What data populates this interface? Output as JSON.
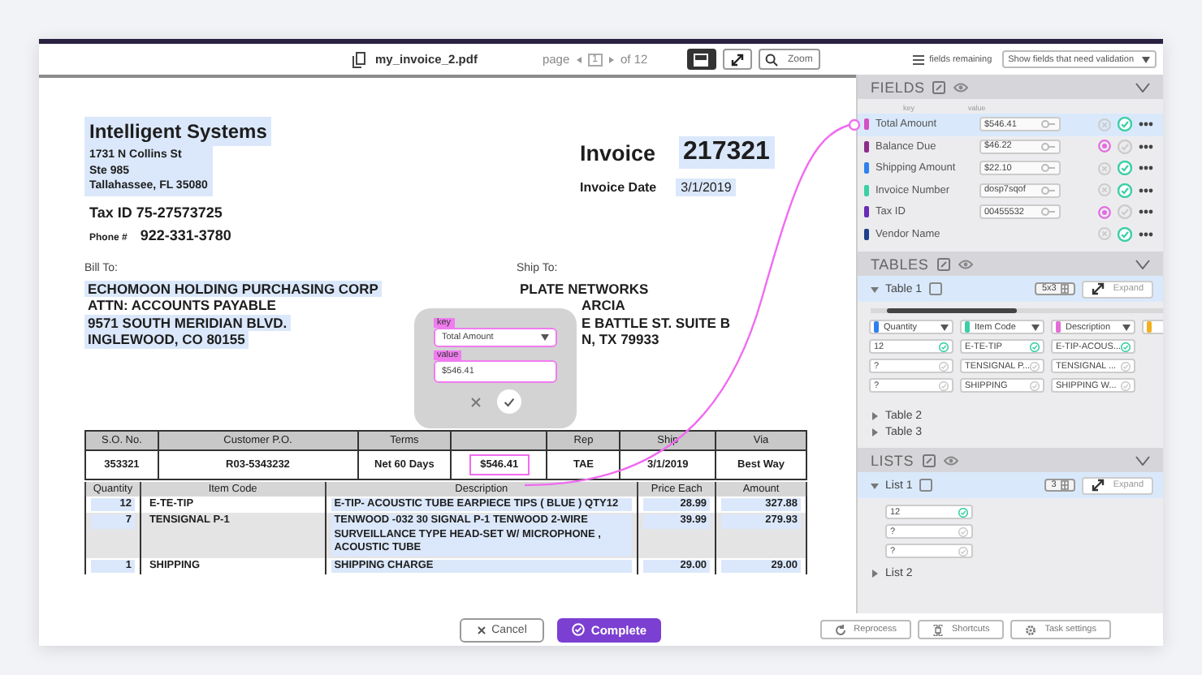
{
  "toolbar": {
    "file_name": "my_invoice_2.pdf",
    "page_label": "page",
    "page_number": "1",
    "page_total": "of 12",
    "zoom_label": "Zoom",
    "fields_remaining": "fields remaining",
    "filter": "Show fields that need validation"
  },
  "document": {
    "company": {
      "name": "Intelligent Systems",
      "address": [
        "1731 N Collins St",
        "Ste 985",
        "Tallahassee, FL 35080"
      ]
    },
    "tax_id": "Tax ID 75-27573725",
    "phone_label": "Phone #",
    "phone": "922-331-3780",
    "invoice_label": "Invoice",
    "invoice_number": "217321",
    "date_label": "Invoice Date",
    "date": "3/1/2019",
    "bill_to": {
      "label": "Bill To:",
      "lines": [
        {
          "text": "ECHOMOON HOLDING PURCHASING CORP",
          "highlighted": true
        },
        {
          "text": "ATTN: ACCOUNTS PAYABLE",
          "highlighted": false
        },
        {
          "text": "9571 SOUTH MERIDIAN BLVD.",
          "highlighted": true
        },
        {
          "text": "INGLEWOOD, CO 80155",
          "highlighted": true
        }
      ]
    },
    "ship_to": {
      "label": "Ship To:",
      "lines": [
        {
          "text": "PLATE NETWORKS",
          "kind": "full"
        },
        {
          "text": "ARCIA",
          "kind": "partial"
        },
        {
          "text": "E BATTLE ST. SUITE B",
          "kind": "partial"
        },
        {
          "text": "N, TX 79933",
          "kind": "partial"
        }
      ]
    },
    "summary": {
      "columns": [
        {
          "kind": "text",
          "label": "S.O. No."
        },
        {
          "kind": "text",
          "label": "Customer P.O."
        },
        {
          "kind": "text",
          "label": "Terms"
        },
        {
          "kind": "covered"
        },
        {
          "kind": "text",
          "label": "Rep"
        },
        {
          "kind": "text",
          "label": "Ship"
        },
        {
          "kind": "text",
          "label": "Via"
        }
      ],
      "row": [
        {
          "text": "353321",
          "selected": false
        },
        {
          "text": "R03-5343232",
          "selected": false
        },
        {
          "text": "Net 60 Days",
          "selected": false
        },
        {
          "text": "$546.41",
          "selected": true
        },
        {
          "text": "TAE",
          "selected": false
        },
        {
          "text": "3/1/2019",
          "selected": false
        },
        {
          "text": "Best Way",
          "selected": false
        }
      ]
    },
    "items": {
      "columns": [
        "Quantity",
        "Item Code",
        "Description",
        "Price Each",
        "Amount"
      ],
      "rows": [
        {
          "selected": false,
          "cells": [
            "12",
            "E-TE-TIP",
            "E-TIP- ACOUSTIC TUBE EARPIECE TIPS ( BLUE ) QTY12",
            "28.99",
            "327.88"
          ]
        },
        {
          "selected": true,
          "cells": [
            "7",
            "TENSIGNAL P-1",
            "TENWOOD -032 30  SIGNAL P-1 TENWOOD 2-WIRE SURVEILLANCE TYPE HEAD-SET W/ MICROPHONE , ACOUSTIC TUBE",
            "39.99",
            "279.93"
          ]
        },
        {
          "selected": false,
          "cells": [
            "1",
            "SHIPPING",
            "SHIPPING CHARGE",
            "29.00",
            "29.00"
          ]
        }
      ]
    }
  },
  "popup": {
    "key_label": "key",
    "key": "Total Amount",
    "value_label": "value",
    "value": "$546.41"
  },
  "actions": [
    {
      "label": "Cancel",
      "kind": "secondary"
    },
    {
      "label": "Complete",
      "kind": "primary"
    }
  ],
  "panel": {
    "fields": {
      "title": "FIELDS",
      "key_header": "key",
      "value_header": "value",
      "items": [
        {
          "name": "Total Amount",
          "color": "#d452c4",
          "value": "$546.41",
          "checked": true,
          "flagged": false,
          "selected": true
        },
        {
          "name": "Balance Due",
          "color": "#8b2d8b",
          "value": "$46.22",
          "checked": false,
          "flagged": true,
          "selected": false
        },
        {
          "name": "Shipping Amount",
          "color": "#2f80ed",
          "value": "$22.10",
          "checked": true,
          "flagged": false,
          "selected": false
        },
        {
          "name": "Invoice Number",
          "color": "#3ccfa6",
          "value": "dosp7sqof",
          "checked": true,
          "flagged": false,
          "selected": false
        },
        {
          "name": "Tax ID",
          "color": "#6a2bb5",
          "value": "00455532",
          "checked": false,
          "flagged": true,
          "selected": false
        },
        {
          "name": "Vendor Name",
          "color": "#1e3f8a",
          "checked": true,
          "flagged": false,
          "selected": false
        }
      ]
    },
    "tables": {
      "title": "TABLES",
      "items": [
        {
          "name": "Table 1",
          "expanded": true,
          "size": "5x3",
          "expand_label": "Expand",
          "columns": [
            {
              "label": "Quantity",
              "color": "#2f80ed"
            },
            {
              "label": "Item Code",
              "color": "#3ccfa6"
            },
            {
              "label": "Description",
              "color": "#e56bd6"
            },
            {
              "color": "#f2b01e"
            }
          ],
          "rows": [
            [
              {
                "text": "12",
                "validated": true
              },
              {
                "text": "E-TE-TIP",
                "validated": true
              },
              {
                "text": "E-TIP-ACOUS...",
                "validated": true
              }
            ],
            [
              {
                "text": "?",
                "validated": false
              },
              {
                "text": "TENSIGNAL P...",
                "validated": false
              },
              {
                "text": "TENSIGNAL ...",
                "validated": false
              }
            ],
            [
              {
                "text": "?",
                "validated": false
              },
              {
                "text": "SHIPPING",
                "validated": false
              },
              {
                "text": "SHIPPING W...",
                "validated": false
              }
            ]
          ]
        },
        {
          "name": "Table 2",
          "expanded": false
        },
        {
          "name": "Table 3",
          "expanded": false
        }
      ]
    },
    "lists": {
      "title": "LISTS",
      "items": [
        {
          "name": "List 1",
          "expanded": true,
          "size": "3",
          "expand_label": "Expand",
          "values": [
            {
              "text": "12",
              "validated": true
            },
            {
              "text": "?",
              "validated": false
            },
            {
              "text": "?",
              "validated": false
            }
          ]
        },
        {
          "name": "List 2",
          "expanded": false
        }
      ]
    },
    "footer": [
      "Reprocess",
      "Shortcuts",
      "Task settings"
    ]
  }
}
